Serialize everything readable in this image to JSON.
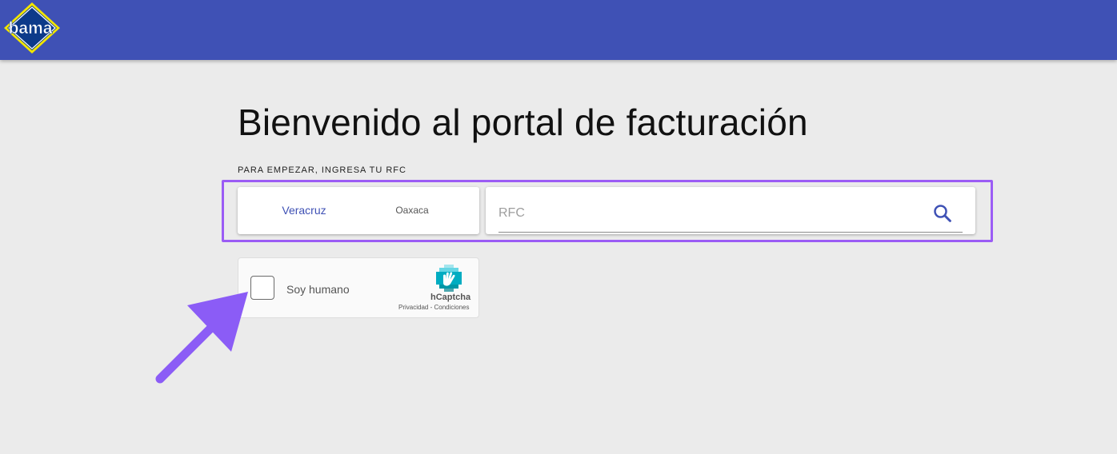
{
  "header": {
    "logo_text": "bama",
    "brand_color": "#3f51b5"
  },
  "main": {
    "title": "Bienvenido al portal de facturación",
    "instruction": "PARA EMPEZAR, INGRESA TU RFC",
    "regions": [
      {
        "label": "Veracruz",
        "selected": true
      },
      {
        "label": "Oaxaca",
        "selected": false
      }
    ],
    "search": {
      "placeholder": "RFC",
      "icon": "search-icon"
    }
  },
  "captcha": {
    "label": "Soy humano",
    "brand": "hCaptcha",
    "privacy": "Privacidad",
    "separator": " - ",
    "terms": "Condiciones"
  },
  "annotation": {
    "highlight_color": "#9b5cf5",
    "arrow_color": "#8b5cf6"
  }
}
